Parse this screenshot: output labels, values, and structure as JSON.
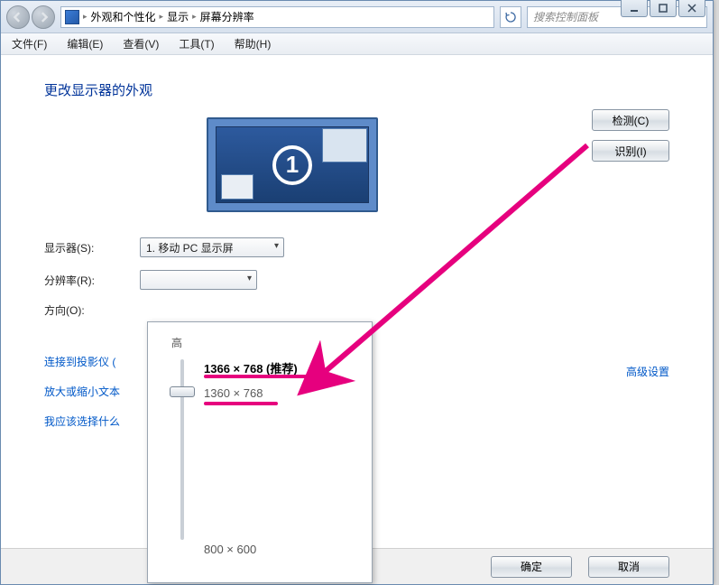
{
  "caption": {
    "min": "—",
    "max": "▢",
    "close": "✕"
  },
  "nav": {
    "crumbs": [
      "外观和个性化",
      "显示",
      "屏幕分辨率"
    ],
    "search_placeholder": "搜索控制面板"
  },
  "menu": {
    "file": "文件(F)",
    "edit": "编辑(E)",
    "view": "查看(V)",
    "tools": "工具(T)",
    "help": "帮助(H)"
  },
  "page": {
    "title": "更改显示器的外观",
    "detect": "检测(C)",
    "identify": "识别(I)",
    "monitor_number": "1",
    "display_label": "显示器(S):",
    "display_value": "1. 移动 PC 显示屏",
    "res_label": "分辨率(R):",
    "orient_label": "方向(O):",
    "adv_link": "高级设置",
    "links": {
      "projector": "连接到投影仪 (",
      "zoom": "放大或缩小文本",
      "choose": "我应该选择什么"
    },
    "ok": "确定",
    "cancel": "取消"
  },
  "res_popup": {
    "high": "高",
    "recommended": "1366 × 768 (推荐)",
    "opt2": "1360 × 768",
    "low": "800 × 600"
  }
}
